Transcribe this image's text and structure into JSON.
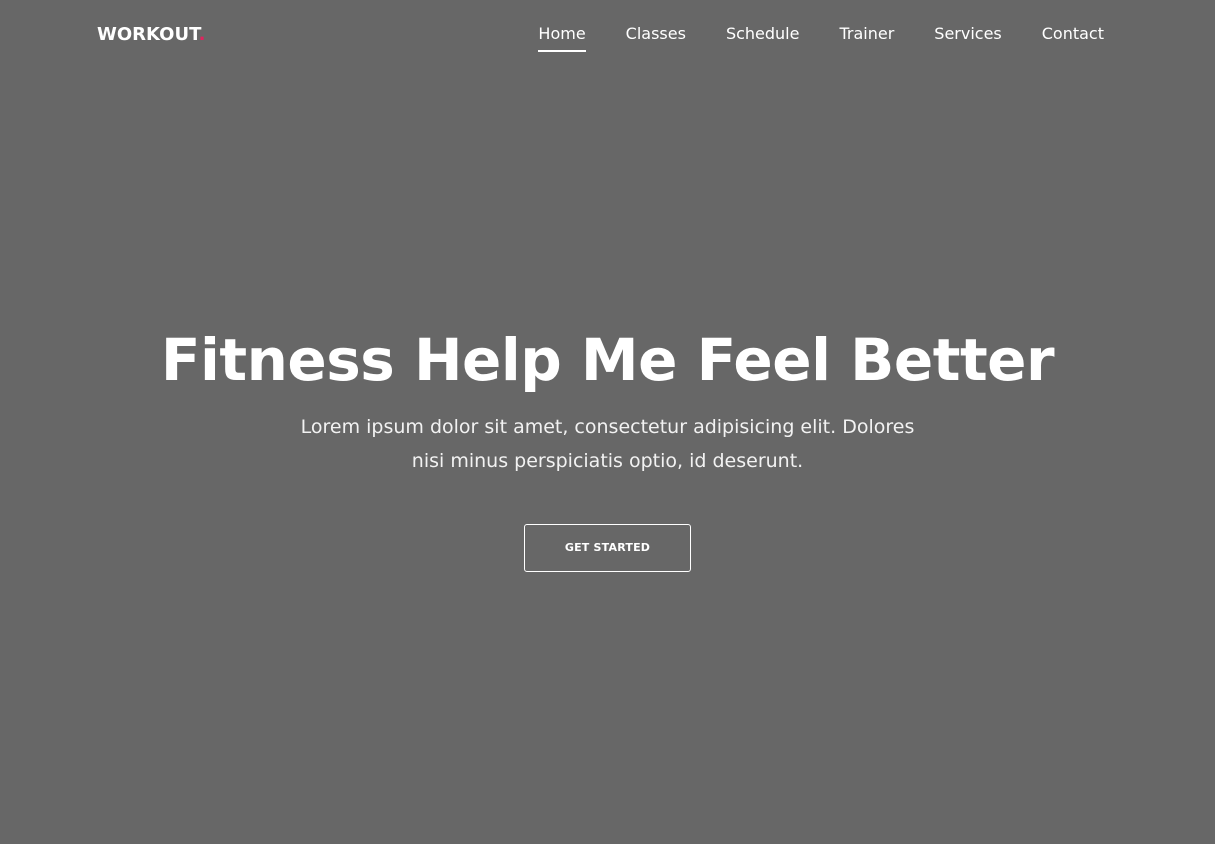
{
  "header": {
    "logo_text": "WORKOUT",
    "logo_dot": ".",
    "nav": [
      {
        "label": "Home",
        "active": true
      },
      {
        "label": "Classes",
        "active": false
      },
      {
        "label": "Schedule",
        "active": false
      },
      {
        "label": "Trainer",
        "active": false
      },
      {
        "label": "Services",
        "active": false
      },
      {
        "label": "Contact",
        "active": false
      }
    ]
  },
  "hero": {
    "title": "Fitness Help Me Feel Better",
    "subtitle": "Lorem ipsum dolor sit amet, consectetur adipisicing elit. Dolores nisi minus perspiciatis optio, id deserunt.",
    "cta_label": "GET STARTED"
  },
  "colors": {
    "background": "#676767",
    "text": "#ffffff",
    "accent": "#e0245e"
  }
}
